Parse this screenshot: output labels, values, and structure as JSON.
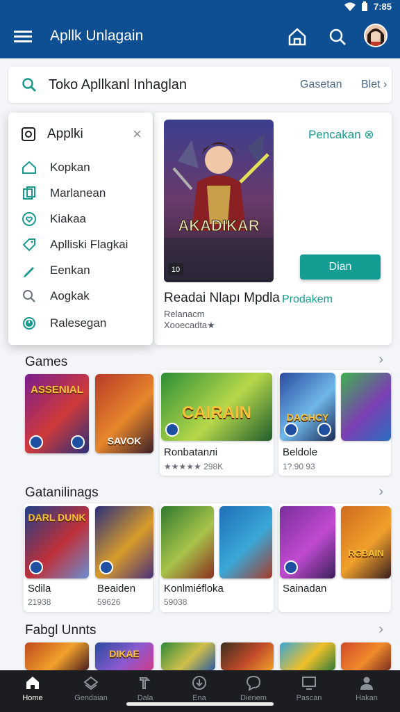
{
  "status": {
    "time": "7:85"
  },
  "app_bar": {
    "title": "Apllk Unlagain"
  },
  "search": {
    "text": "Toko Apllkanl Inhaglan",
    "link1": "Gasetan",
    "link2": "Blet ›"
  },
  "popup": {
    "title": "Applki",
    "close": "×",
    "items": [
      {
        "label": "Kopkan",
        "icon": "home-outline-icon"
      },
      {
        "label": "Marlanean",
        "icon": "copy-icon"
      },
      {
        "label": "Kiakaa",
        "icon": "heart-icon"
      },
      {
        "label": "Aplliski Flagkai",
        "icon": "tag-icon"
      },
      {
        "label": "Eenkan",
        "icon": "pencil-icon"
      },
      {
        "label": "Aogkak",
        "icon": "search-icon"
      },
      {
        "label": "Ralesegan",
        "icon": "clock-icon"
      }
    ]
  },
  "feature": {
    "art_text": "AKADIKAR",
    "art_badge": "10",
    "link": "Pencakan ⊗",
    "button": "Dian",
    "title": "Readai Nlapı Mpdla",
    "tag": "Prodakem",
    "subtitle": "Relanacm",
    "rating": "Xooecadta★"
  },
  "sections": [
    {
      "title": "Games",
      "arrow": "›",
      "tiles": [
        {
          "word": "ASSENIAL",
          "colors": [
            "#7a1d8f",
            "#d03a3a",
            "#2a2f7a"
          ]
        },
        {
          "word": "SAVOK",
          "colors": [
            "#b73a28",
            "#e7862b",
            "#3a1f2a"
          ]
        },
        {
          "word": "CAIRAIN",
          "colors": [
            "#2d8f36",
            "#b6d84a",
            "#1f5c2d"
          ]
        },
        {
          "word": "DAGHCY",
          "colors": [
            "#2a4c9e",
            "#6fb7e9",
            "#1a2a55"
          ]
        },
        {
          "word": "",
          "colors": [
            "#3eb24f",
            "#7b3fb2",
            "#2a6fc1"
          ]
        }
      ],
      "cards": [
        {
          "name": "Ronbatanлi",
          "meta": "★★★★★ 298K"
        },
        {
          "name": "Beldole",
          "meta": "1?.90 93"
        }
      ]
    },
    {
      "title": "Gatanilinags",
      "arrow": "›",
      "tiles": [
        {
          "word": "DARL DUNK",
          "colors": [
            "#1e3f86",
            "#c0303a",
            "#6b8fd0"
          ]
        },
        {
          "word": "",
          "colors": [
            "#2a2f7a",
            "#d89b2a",
            "#4a2f7a"
          ]
        },
        {
          "word": "",
          "colors": [
            "#2f7a2f",
            "#a8c34a",
            "#8a2f1f"
          ]
        },
        {
          "word": "",
          "colors": [
            "#1f6fb7",
            "#3aa7d6",
            "#a83a2a"
          ]
        },
        {
          "word": "",
          "colors": [
            "#7a2f9a",
            "#c04ad0",
            "#3a1f5a"
          ]
        },
        {
          "word": "RGBAIN",
          "colors": [
            "#d06a1f",
            "#f0a02a",
            "#3a1f1f"
          ]
        }
      ],
      "cards": [
        {
          "name": "Sdila",
          "meta": "21938"
        },
        {
          "name": "Beaiden",
          "meta": "59626"
        },
        {
          "name": "Konlmiéfloka",
          "meta": "59038"
        },
        {
          "name": "Sainadan",
          "meta": ""
        }
      ]
    },
    {
      "title": "Fabgl Unnts",
      "arrow": "›",
      "tiles": [
        {
          "word": "",
          "colors": [
            "#c04a1f",
            "#f0a02a",
            "#4a1f1f"
          ]
        },
        {
          "word": "DIKAE",
          "colors": [
            "#2a4c9e",
            "#8a5ad0",
            "#d03a8a"
          ]
        },
        {
          "word": "",
          "colors": [
            "#2f8a3a",
            "#d0c04a",
            "#2a5a9e"
          ]
        },
        {
          "word": "",
          "colors": [
            "#3a2f1f",
            "#c04a2a",
            "#f0a02a"
          ]
        },
        {
          "word": "",
          "colors": [
            "#3aa7d6",
            "#f0c02a",
            "#2f7a3a"
          ]
        },
        {
          "word": "",
          "colors": [
            "#d04a2a",
            "#f08a2a",
            "#7a2f1f"
          ]
        }
      ]
    }
  ],
  "nav": [
    {
      "label": "Home",
      "icon": "home-icon",
      "active": true
    },
    {
      "label": "Gendaian",
      "icon": "layers-icon",
      "active": false
    },
    {
      "label": "Dala",
      "icon": "hammer-icon",
      "active": false
    },
    {
      "label": "Ena",
      "icon": "download-icon",
      "active": false
    },
    {
      "label": "Dienem",
      "icon": "chat-icon",
      "active": false
    },
    {
      "label": "Pascan",
      "icon": "monitor-icon",
      "active": false
    },
    {
      "label": "Hakan",
      "icon": "person-icon",
      "active": false
    }
  ]
}
